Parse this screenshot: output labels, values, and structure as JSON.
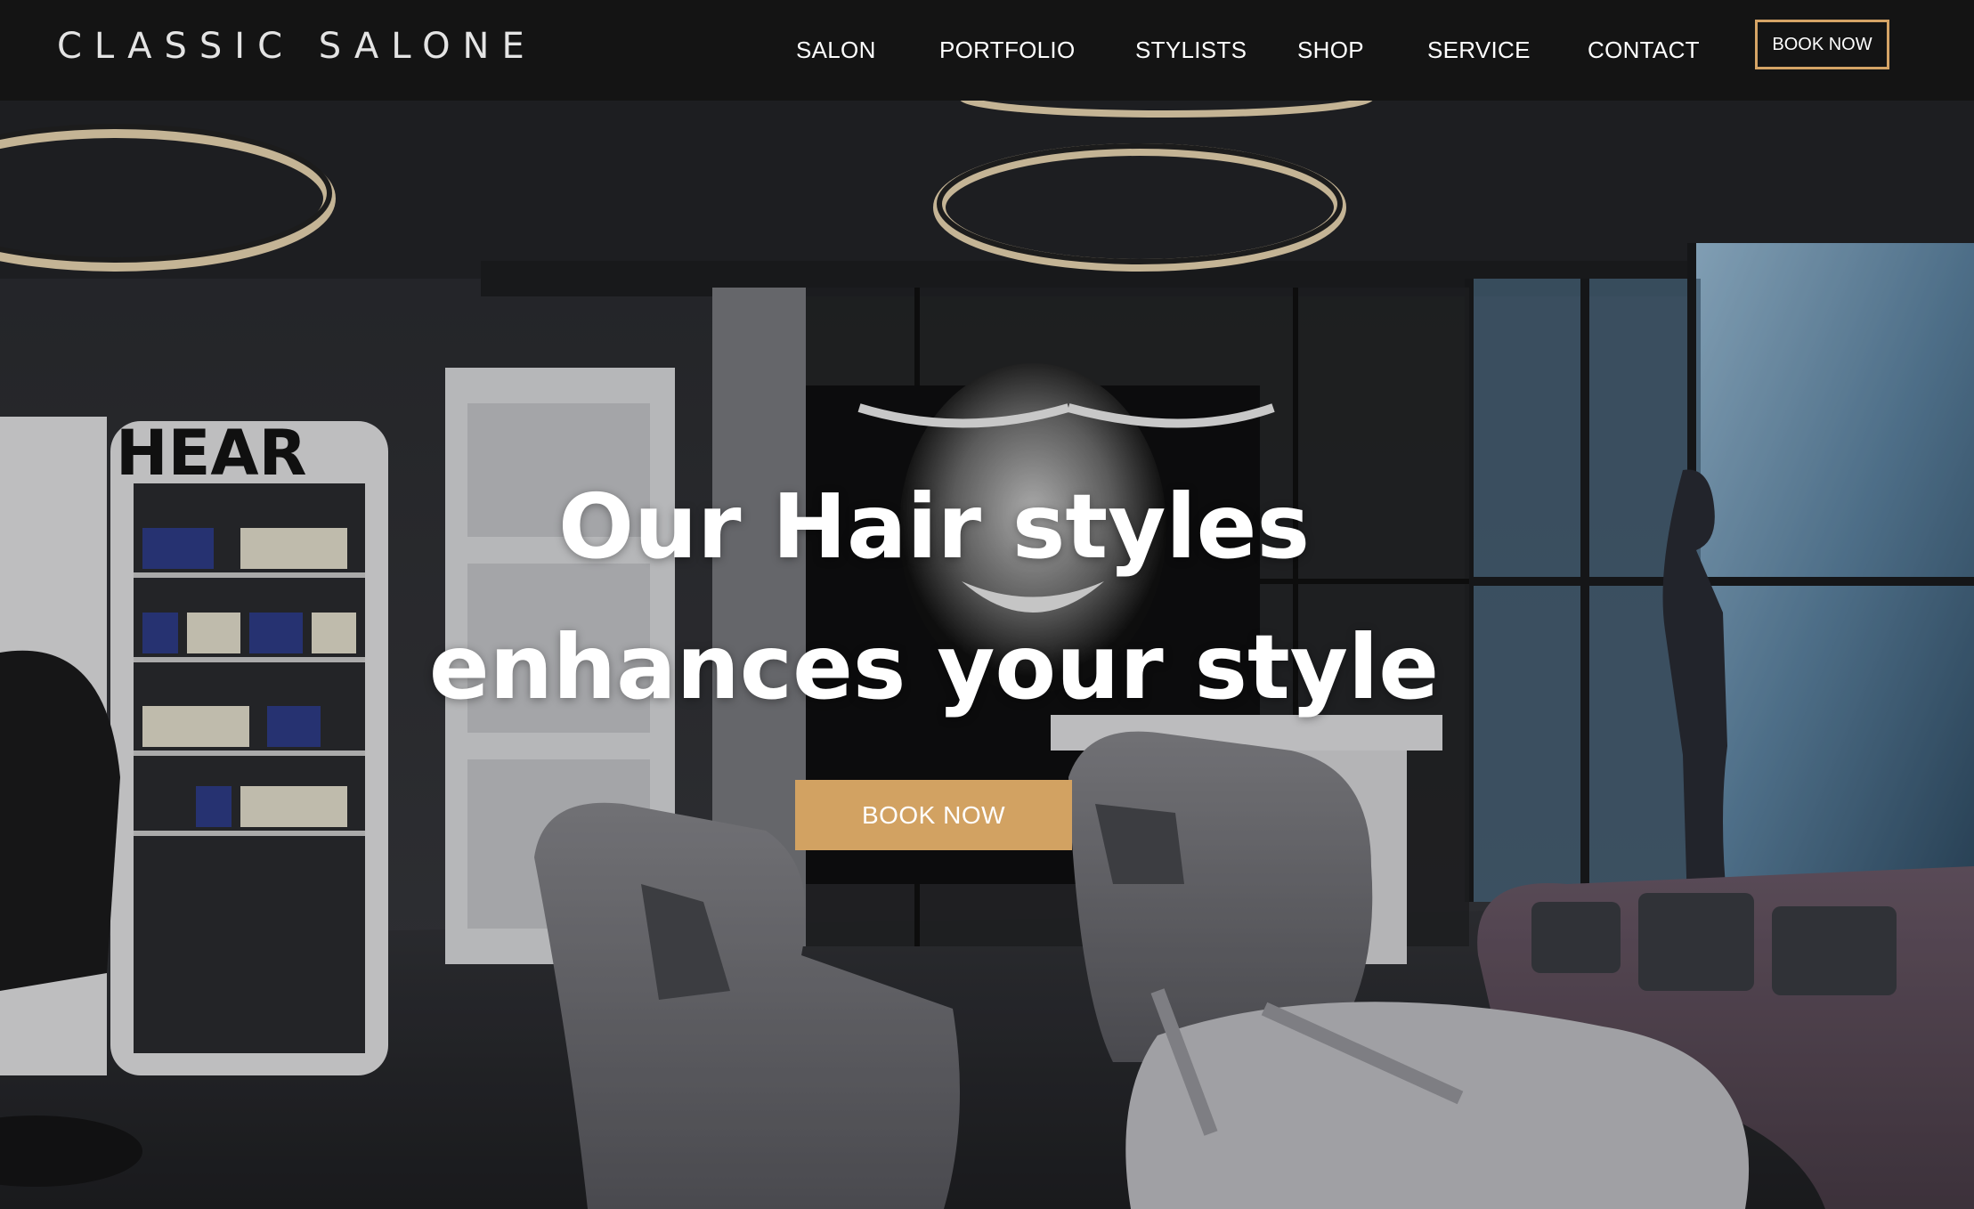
{
  "brand": {
    "logo_text": "CLASSIC SALONE"
  },
  "nav": {
    "items": [
      {
        "label": "SALON"
      },
      {
        "label": "PORTFOLIO"
      },
      {
        "label": "STYLISTS"
      },
      {
        "label": "SHOP"
      },
      {
        "label": "SERVICE"
      },
      {
        "label": "CONTACT"
      }
    ],
    "book_button": "BOOK NOW"
  },
  "hero": {
    "title_line1": "Our Hair styles",
    "title_line2": "enhances your style",
    "book_button": "BOOK NOW",
    "shelf_sign": "HEAR"
  },
  "colors": {
    "header_bg": "#141414",
    "accent_gold": "#d2a262",
    "text_white": "#ffffff"
  }
}
